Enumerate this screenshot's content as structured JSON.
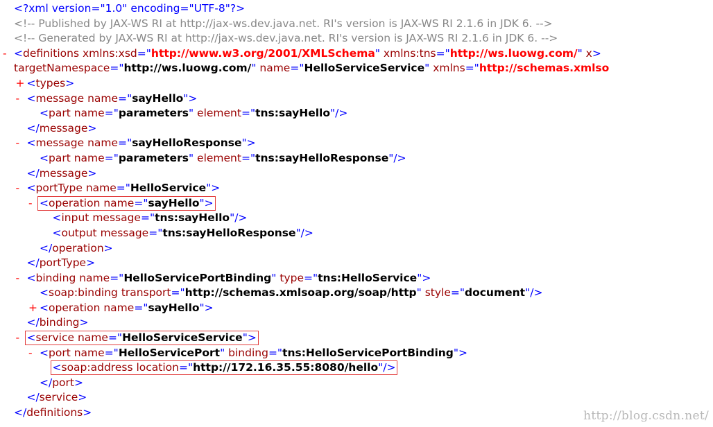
{
  "xml": {
    "lines": [
      {
        "indent": 0,
        "toggle": "",
        "html": "<span class='pi'>&lt;?xml version=\"1.0\" encoding=\"UTF-8\"?&gt;</span>",
        "kind": "pi"
      },
      {
        "indent": 0,
        "toggle": "",
        "text": "<!-- Published by JAX-WS RI at http://jax-ws.dev.java.net. RI's version is JAX-WS RI 2.1.6 in JDK 6. -->",
        "kind": "comment"
      },
      {
        "indent": 0,
        "toggle": "",
        "text": "<!-- Generated by JAX-WS RI at http://jax-ws.dev.java.net. RI's version is JAX-WS RI 2.1.6 in JDK 6. -->",
        "kind": "comment"
      },
      {
        "indent": 0,
        "toggle": "-",
        "kind": "tag",
        "open": true,
        "name": "definitions",
        "attrs": [
          [
            "xmlns:xsd",
            "http://www.w3.org/2001/XMLSchema",
            "ns"
          ],
          [
            "xmlns:tns",
            "http://ws.luowg.com/",
            "ns"
          ],
          [
            "x",
            "",
            "trunc"
          ]
        ]
      },
      {
        "indent": 0,
        "toggle": "",
        "kind": "cont",
        "attrs": [
          [
            "targetNamespace",
            "http://ws.luowg.com/",
            "v"
          ],
          [
            "name",
            "HelloServiceService",
            "v"
          ],
          [
            "xmlns",
            "http://schemas.xmlso",
            "ns-trunc"
          ]
        ]
      },
      {
        "indent": 1,
        "toggle": "+",
        "kind": "tag",
        "open": true,
        "name": "types",
        "attrs": []
      },
      {
        "indent": 1,
        "toggle": "-",
        "kind": "tag",
        "open": true,
        "name": "message",
        "attrs": [
          [
            "name",
            "sayHello",
            "v"
          ]
        ]
      },
      {
        "indent": 2,
        "toggle": "",
        "kind": "tag",
        "self": true,
        "name": "part",
        "attrs": [
          [
            "name",
            "parameters",
            "v"
          ],
          [
            "element",
            "tns:sayHello",
            "v"
          ]
        ]
      },
      {
        "indent": 1,
        "toggle": "",
        "kind": "close",
        "name": "message"
      },
      {
        "indent": 1,
        "toggle": "-",
        "kind": "tag",
        "open": true,
        "name": "message",
        "attrs": [
          [
            "name",
            "sayHelloResponse",
            "v"
          ]
        ]
      },
      {
        "indent": 2,
        "toggle": "",
        "kind": "tag",
        "self": true,
        "name": "part",
        "attrs": [
          [
            "name",
            "parameters",
            "v"
          ],
          [
            "element",
            "tns:sayHelloResponse",
            "v"
          ]
        ]
      },
      {
        "indent": 1,
        "toggle": "",
        "kind": "close",
        "name": "message"
      },
      {
        "indent": 1,
        "toggle": "-",
        "kind": "tag",
        "open": true,
        "name": "portType",
        "attrs": [
          [
            "name",
            "HelloService",
            "v"
          ]
        ]
      },
      {
        "indent": 2,
        "toggle": "-",
        "kind": "tag",
        "open": true,
        "name": "operation",
        "attrs": [
          [
            "name",
            "sayHello",
            "v"
          ]
        ],
        "highlight": true
      },
      {
        "indent": 3,
        "toggle": "",
        "kind": "tag",
        "self": true,
        "name": "input",
        "attrs": [
          [
            "message",
            "tns:sayHello",
            "v"
          ]
        ]
      },
      {
        "indent": 3,
        "toggle": "",
        "kind": "tag",
        "self": true,
        "name": "output",
        "attrs": [
          [
            "message",
            "tns:sayHelloResponse",
            "v"
          ]
        ]
      },
      {
        "indent": 2,
        "toggle": "",
        "kind": "close",
        "name": "operation"
      },
      {
        "indent": 1,
        "toggle": "",
        "kind": "close",
        "name": "portType"
      },
      {
        "indent": 1,
        "toggle": "-",
        "kind": "tag",
        "open": true,
        "name": "binding",
        "attrs": [
          [
            "name",
            "HelloServicePortBinding",
            "v"
          ],
          [
            "type",
            "tns:HelloService",
            "v"
          ]
        ]
      },
      {
        "indent": 2,
        "toggle": "",
        "kind": "tag",
        "self": true,
        "name": "soap:binding",
        "attrs": [
          [
            "transport",
            "http://schemas.xmlsoap.org/soap/http",
            "v"
          ],
          [
            "style",
            "document",
            "v"
          ]
        ]
      },
      {
        "indent": 2,
        "toggle": "+",
        "kind": "tag",
        "open": true,
        "name": "operation",
        "attrs": [
          [
            "name",
            "sayHello",
            "v"
          ]
        ]
      },
      {
        "indent": 1,
        "toggle": "",
        "kind": "close",
        "name": "binding"
      },
      {
        "indent": 1,
        "toggle": "-",
        "kind": "tag",
        "open": true,
        "name": "service",
        "attrs": [
          [
            "name",
            "HelloServiceService",
            "v"
          ]
        ],
        "highlight": true
      },
      {
        "indent": 2,
        "toggle": "-",
        "kind": "tag",
        "open": true,
        "name": "port",
        "attrs": [
          [
            "name",
            "HelloServicePort",
            "v"
          ],
          [
            "binding",
            "tns:HelloServicePortBinding",
            "v"
          ]
        ]
      },
      {
        "indent": 3,
        "toggle": "",
        "kind": "tag",
        "self": true,
        "name": "soap:address",
        "attrs": [
          [
            "location",
            "http://172.16.35.55:8080/hello",
            "v"
          ]
        ],
        "highlight": true
      },
      {
        "indent": 2,
        "toggle": "",
        "kind": "close",
        "name": "port"
      },
      {
        "indent": 1,
        "toggle": "",
        "kind": "close",
        "name": "service"
      },
      {
        "indent": 0,
        "toggle": "",
        "kind": "close",
        "name": "definitions"
      }
    ]
  },
  "watermark": "http://blog.csdn.net/"
}
